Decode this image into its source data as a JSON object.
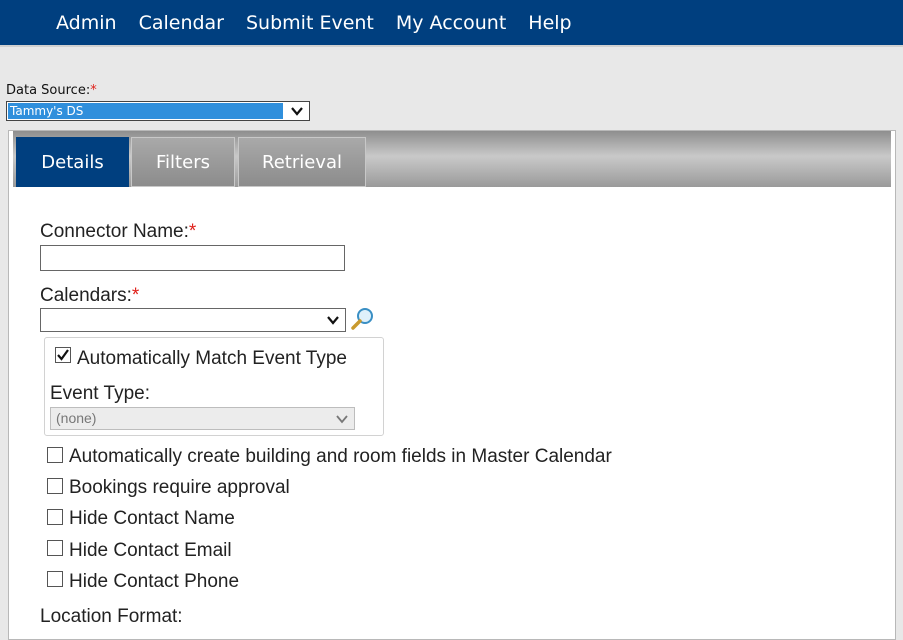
{
  "nav": {
    "items": [
      "Admin",
      "Calendar",
      "Submit Event",
      "My Account",
      "Help"
    ]
  },
  "data_source": {
    "label": "Data Source:",
    "required_mark": "*",
    "value": "Tammy's DS"
  },
  "tabs": [
    {
      "label": "Details",
      "active": true
    },
    {
      "label": "Filters",
      "active": false
    },
    {
      "label": "Retrieval",
      "active": false
    }
  ],
  "form": {
    "connector_name": {
      "label": "Connector Name:",
      "required_mark": "*",
      "value": ""
    },
    "calendars": {
      "label": "Calendars:",
      "required_mark": "*",
      "value": ""
    },
    "auto_match": {
      "label": "Automatically Match Event Type",
      "checked": true
    },
    "event_type": {
      "label": "Event Type:",
      "value": "(none)"
    },
    "checkboxes": [
      {
        "label": "Automatically create building and room fields in Master Calendar",
        "checked": false
      },
      {
        "label": "Bookings require approval",
        "checked": false
      },
      {
        "label": "Hide Contact Name",
        "checked": false
      },
      {
        "label": "Hide Contact Email",
        "checked": false
      },
      {
        "label": "Hide Contact Phone",
        "checked": false
      }
    ],
    "location_format": {
      "label": "Location Format:"
    }
  },
  "colors": {
    "topbar": "#003f7f",
    "active_tab": "#003f7f",
    "selection": "#2f8fdc",
    "required": "#e0201a"
  },
  "icons": {
    "magnifier": "magnifier-icon",
    "dropdown": "chevron-down-icon",
    "check": "checkmark-icon"
  }
}
